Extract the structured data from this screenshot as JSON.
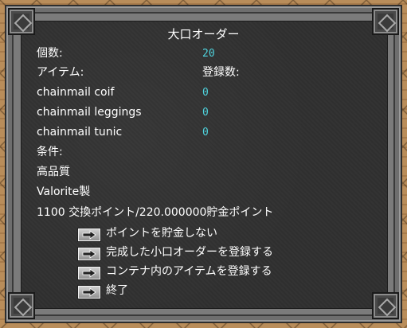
{
  "dialog": {
    "title": "大口オーダー",
    "quantity_label": "個数:",
    "quantity_value": "20",
    "items_header": "アイテム:",
    "registered_header": "登録数:",
    "items": [
      {
        "name": "chainmail coif",
        "count": "0"
      },
      {
        "name": "chainmail leggings",
        "count": "0"
      },
      {
        "name": "chainmail tunic",
        "count": "0"
      }
    ],
    "conditions_label": "条件:",
    "quality": "高品質",
    "material": "Valorite製",
    "reward": "1100 交換ポイント/220.000000貯金ポイント"
  },
  "options": [
    {
      "label": "ポイントを貯金しない",
      "icon": "arrow-right-icon"
    },
    {
      "label": "完成した小口オーダーを登録する",
      "icon": "arrow-right-icon"
    },
    {
      "label": "コンテナ内のアイテムを登録する",
      "icon": "arrow-right-icon"
    },
    {
      "label": "終了",
      "icon": "arrow-right-icon"
    }
  ],
  "colors": {
    "text": "#ffffff",
    "value": "#4fd3dd",
    "panel": "#333333"
  }
}
